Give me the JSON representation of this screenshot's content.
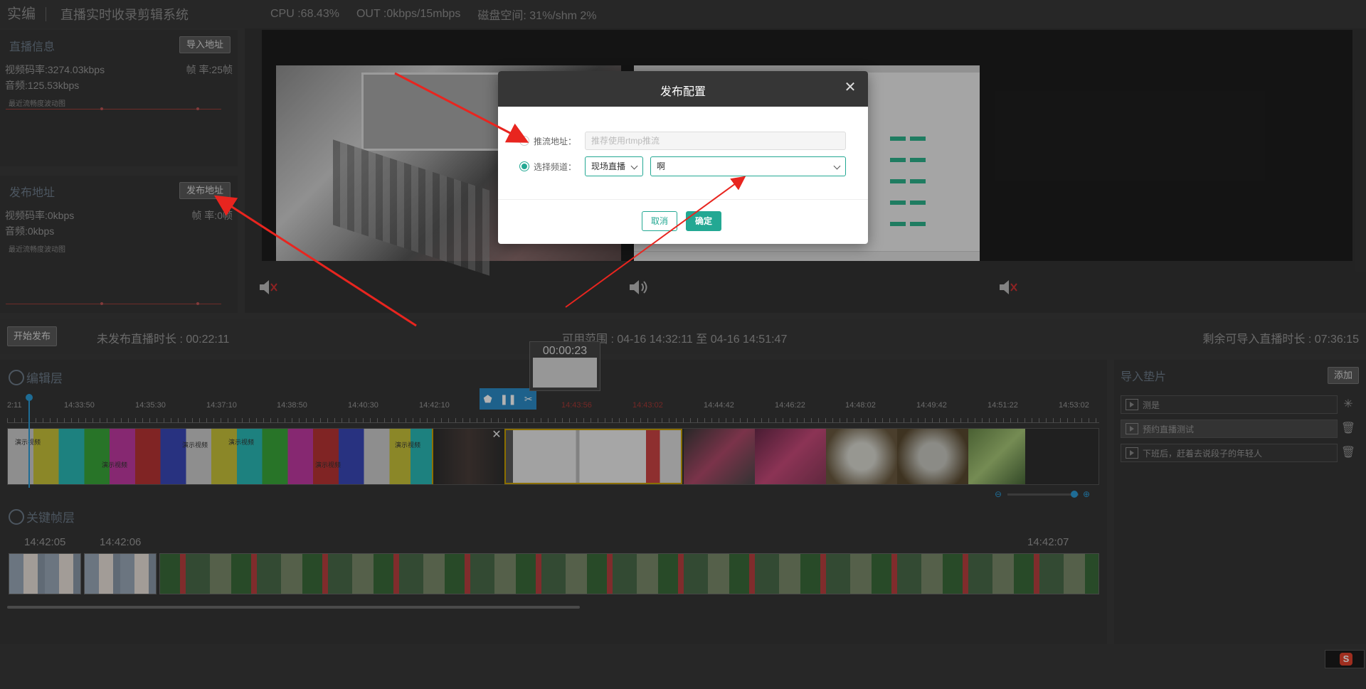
{
  "header": {
    "brand": "实编",
    "system": "直播实时收录剪辑系统",
    "cpu": "CPU :68.43%",
    "out": "OUT :0kbps/15mbps",
    "disk": "磁盘空间: 31%/shm 2%"
  },
  "live_info": {
    "title": "直播信息",
    "button": "导入地址",
    "video_rate": "视频码率:3274.03kbps",
    "frame_rate": "帧    率:25帧",
    "audio_rate": "音频:125.53kbps",
    "wave_label": "最近流畅度波动图"
  },
  "publish_info": {
    "title": "发布地址",
    "button": "发布地址",
    "video_rate": "视频码率:0kbps",
    "frame_rate": "帧    率:0帧",
    "audio_rate": "音频:0kbps",
    "wave_label": "最近流畅度波动图"
  },
  "publish_bar": {
    "start_button": "开始发布",
    "unpublished": "未发布直播时长 : 00:22:11",
    "range": "可用范围 : 04-16 14:32:11 至 04-16 14:51:47",
    "remaining": "剩余可导入直播时长 : 07:36:15"
  },
  "editor": {
    "title": "编辑层",
    "hover_time": "00:00:23",
    "ruler": [
      "2:11",
      "14:33:50",
      "14:35:30",
      "14:37:10",
      "14:38:50",
      "14:40:30",
      "14:42:10",
      "14:43:56",
      "14:43:02",
      "14:44:42",
      "14:46:22",
      "14:48:02",
      "14:49:42",
      "14:51:22",
      "14:53:02"
    ],
    "clip_caption": "演示视频",
    "keyframe_title": "关键帧层",
    "keyframe_times": [
      "14:42:05",
      "14:42:06",
      "14:42:07"
    ]
  },
  "pads": {
    "title": "导入垫片",
    "add_button": "添加",
    "items": [
      "测是",
      "预约直播测试",
      "下班后，赶着去说段子的年轻人"
    ]
  },
  "modal": {
    "title": "发布配置",
    "push_label": "推流地址：",
    "push_placeholder": "推荐使用rtmp推流",
    "channel_label": "选择频道：",
    "channel_type": "现场直播",
    "channel_value": "啊",
    "cancel": "取消",
    "ok": "确定"
  },
  "colors": {
    "accent": "#23a893",
    "timeline_blue": "#2b9bd6",
    "arrow": "#e8251f"
  },
  "icons": [
    "speaker-muted-icon",
    "speaker-icon",
    "close-icon",
    "scissors-icon",
    "pause-icon",
    "trash-icon",
    "play-file-icon",
    "sogou-ime-icon"
  ]
}
